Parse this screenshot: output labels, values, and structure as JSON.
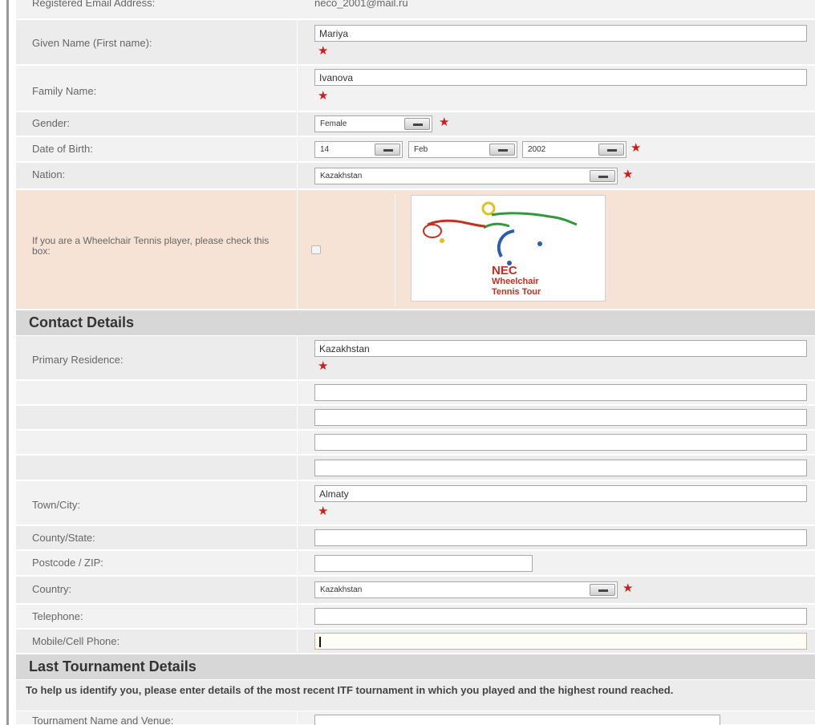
{
  "personal": {
    "email_label": "Registered Email Address:",
    "email_value": "neco_2001@mail.ru",
    "given_name_label": "Given Name (First name):",
    "given_name_value": "Mariya",
    "family_name_label": "Family Name:",
    "family_name_value": "Ivanova",
    "gender_label": "Gender:",
    "gender_value": "Female",
    "dob_label": "Date of Birth:",
    "dob_day": "14",
    "dob_month": "Feb",
    "dob_year": "2002",
    "nation_label": "Nation:",
    "nation_value": "Kazakhstan",
    "wheelchair_label": "If you are a Wheelchair Tennis player, please check this box:",
    "wheelchair_checked": false,
    "logo_line1": "NEC",
    "logo_line2": "Wheelchair",
    "logo_line3": "Tennis Tour"
  },
  "contact": {
    "heading": "Contact Details",
    "residence_label": "Primary Residence:",
    "residence_line1": "Kazakhstan",
    "town_label": "Town/City:",
    "town_value": "Almaty",
    "county_label": "County/State:",
    "postcode_label": "Postcode / ZIP:",
    "country_label": "Country:",
    "country_value": "Kazakhstan",
    "telephone_label": "Telephone:",
    "mobile_label": "Mobile/Cell Phone:"
  },
  "tournament": {
    "heading": "Last Tournament Details",
    "note": "To help us identify you, please enter details of the most recent ITF tournament in which you played and the highest round reached.",
    "name_venue_label": "Tournament Name and Venue:"
  },
  "colors": {
    "required": "#d21c1c",
    "section_bg": "#d7d7d7",
    "row_bg": "#f2f2f2",
    "highlight_row": "#f6e3d6",
    "focus_border": "#d9b86a"
  },
  "icons": [
    "required-star-icon",
    "dropdown-arrow-icon",
    "wheelchair-tennis-logo-icon"
  ]
}
